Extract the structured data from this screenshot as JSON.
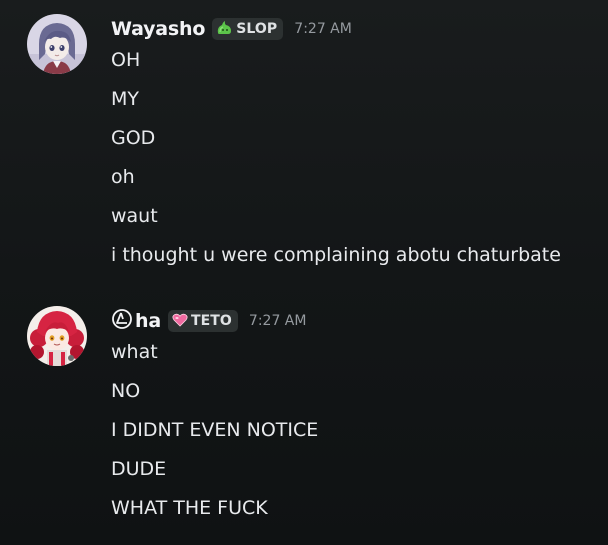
{
  "messages": [
    {
      "author": "Wayasho",
      "tag": "SLOP",
      "tag_icon": "slime-icon",
      "timestamp": "7:27 AM",
      "lines": [
        "OH",
        "MY",
        "GOD",
        "oh",
        "waut",
        "i thought u were complaining abotu chaturbate"
      ]
    },
    {
      "author": "ha",
      "author_prefix_icon": "circled-delta-icon",
      "tag": "TETO",
      "tag_icon": "pink-heart-icon",
      "timestamp": "7:27 AM",
      "lines": [
        "what",
        "NO",
        "I DIDNT EVEN NOTICE",
        "DUDE",
        "WHAT THE FUCK"
      ]
    }
  ],
  "colors": {
    "background": "#131617",
    "username": "#f2f3f5",
    "message_text": "#e8eaed",
    "timestamp": "#959a9f",
    "tag_background": "#2c3131",
    "slime_green": "#5cc44a",
    "heart_pink": "#f06aa0"
  }
}
